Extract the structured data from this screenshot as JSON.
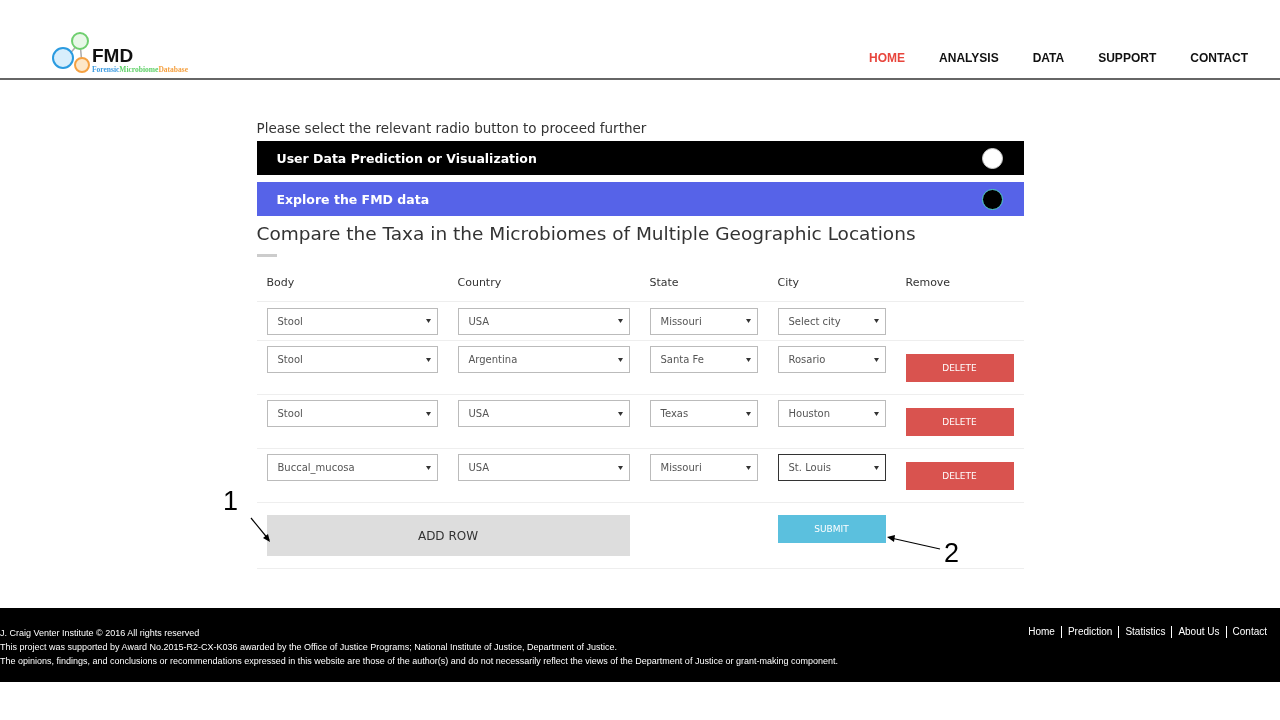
{
  "logo": {
    "title": "FMD",
    "tagline": [
      {
        "text": "Forensic",
        "color": "#3d9be0"
      },
      {
        "text": "Microbiome",
        "color": "#5fd068"
      },
      {
        "text": "Database",
        "color": "#f5a142"
      }
    ]
  },
  "nav": [
    {
      "label": "HOME",
      "selected": true
    },
    {
      "label": "ANALYSIS",
      "selected": false
    },
    {
      "label": "DATA",
      "selected": false
    },
    {
      "label": "SUPPORT",
      "selected": false
    },
    {
      "label": "CONTACT",
      "selected": false
    }
  ],
  "intro": "Please select the relevant radio button to proceed further",
  "options": [
    {
      "label": "User Data Prediction or Visualization",
      "selected": false
    },
    {
      "label": "Explore the FMD data",
      "selected": true
    }
  ],
  "heading": "Compare the Taxa in the Microbiomes of Multiple Geographic Locations",
  "table": {
    "columns": [
      "Body",
      "Country",
      "State",
      "City",
      "Remove"
    ],
    "rows": [
      {
        "body": "Stool",
        "country": "USA",
        "state": "Missouri",
        "city": "Select city",
        "city_focused": false
      },
      {
        "body": "Stool",
        "country": "Argentina",
        "state": "Santa Fe",
        "city": "Rosario",
        "city_focused": false,
        "delete": "DELETE"
      },
      {
        "body": "Stool",
        "country": "USA",
        "state": "Texas",
        "city": "Houston",
        "city_focused": false,
        "delete": "DELETE"
      },
      {
        "body": "Buccal_mucosa",
        "country": "USA",
        "state": "Missouri",
        "city": "St. Louis",
        "city_focused": true,
        "delete": "DELETE"
      }
    ]
  },
  "add_row": "ADD ROW",
  "submit": "SUBMIT",
  "annotations": [
    "1",
    "2"
  ],
  "footer": {
    "lines": [
      "J. Craig Venter Institute © 2016 All rights reserved",
      "This project was supported by Award No.2015-R2-CX-K036 awarded by the Office of Justice Programs; National Institute of Justice, Department of Justice.",
      "The opinions, findings, and conclusions or recommendations expressed in this website are those of the author(s) and do not necessarily reflect the views of the Department of Justice or grant-making component."
    ],
    "links": [
      "Home",
      "Prediction",
      "Statistics",
      "About Us",
      "Contact"
    ]
  }
}
